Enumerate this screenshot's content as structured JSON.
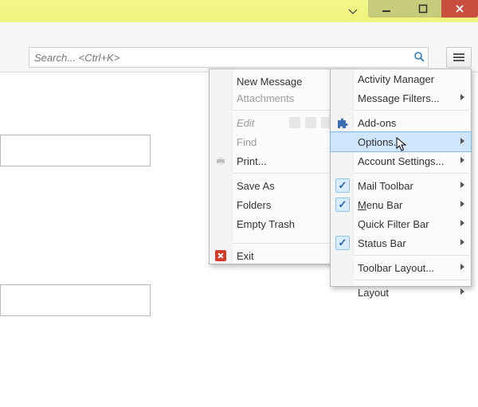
{
  "search": {
    "placeholder": "Search... <Ctrl+K>"
  },
  "appMenu": {
    "newMessage": "New Message",
    "attachments": "Attachments",
    "edit": "Edit",
    "find": "Find",
    "print": "Print...",
    "saveAs": "Save As",
    "folders": "Folders",
    "emptyTrash": "Empty Trash",
    "exit": "Exit"
  },
  "optionsMenu": {
    "activityManager": "Activity Manager",
    "messageFilters": "Message Filters...",
    "addOns": "Add-ons",
    "options": "Options...",
    "accountSettings": "Account Settings...",
    "mailToolbar": "Mail Toolbar",
    "menuBar": "Menu Bar",
    "quickFilterBar": "Quick Filter Bar",
    "statusBar": "Status Bar",
    "toolbarLayout": "Toolbar Layout...",
    "layout": "Layout"
  },
  "checked": {
    "mailToolbar": true,
    "menuBar": true,
    "statusBar": true
  },
  "highlighted": "options",
  "colors": {
    "accent": "#cfe5fb",
    "accentBorder": "#7eb7ee",
    "titlebar": "#eff479",
    "close": "#c94f3f"
  }
}
